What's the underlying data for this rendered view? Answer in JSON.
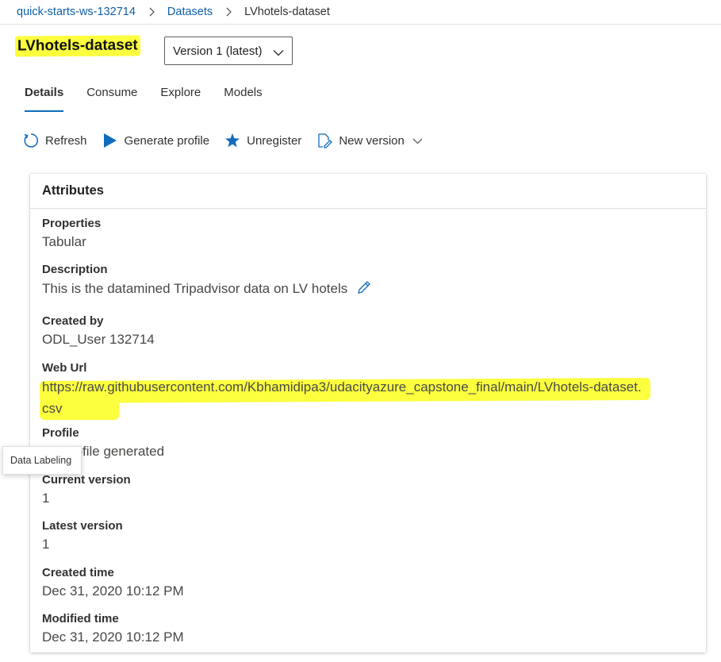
{
  "breadcrumb": {
    "workspace": "quick-starts-ws-132714",
    "datasets": "Datasets",
    "current": "LVhotels-dataset"
  },
  "title": "LVhotels-dataset",
  "version_select": {
    "value": "Version 1 (latest)"
  },
  "tabs": [
    {
      "label": "Details",
      "active": true
    },
    {
      "label": "Consume",
      "active": false
    },
    {
      "label": "Explore",
      "active": false
    },
    {
      "label": "Models",
      "active": false
    }
  ],
  "toolbar": {
    "refresh": "Refresh",
    "generate_profile": "Generate profile",
    "unregister": "Unregister",
    "new_version": "New version"
  },
  "attributes": {
    "header": "Attributes",
    "properties": {
      "label": "Properties",
      "value": "Tabular"
    },
    "description": {
      "label": "Description",
      "value": "This is the datamined Tripadvisor data on LV hotels"
    },
    "created_by": {
      "label": "Created by",
      "value": "ODL_User 132714"
    },
    "web_url": {
      "label": "Web Url",
      "value": "https://raw.githubusercontent.com/Kbhamidipa3/udacityazure_capstone_final/main/LVhotels-dataset.csv"
    },
    "profile": {
      "label": "Profile",
      "value": "No profile generated"
    },
    "current_version": {
      "label": "Current version",
      "value": "1"
    },
    "latest_version": {
      "label": "Latest version",
      "value": "1"
    },
    "created_time": {
      "label": "Created time",
      "value": "Dec 31, 2020 10:12 PM"
    },
    "modified_time": {
      "label": "Modified time",
      "value": "Dec 31, 2020 10:12 PM"
    }
  },
  "tooltip": "Data Labeling",
  "colors": {
    "accent": "#0f6cbd",
    "highlight": "#fbff3d",
    "link": "#0f5ea8"
  }
}
